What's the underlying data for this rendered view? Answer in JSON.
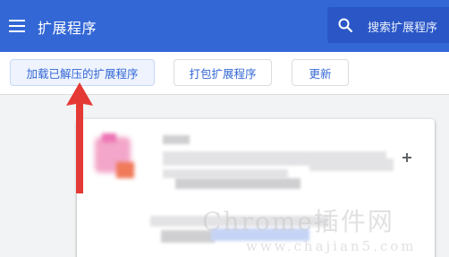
{
  "header": {
    "title": "扩展程序",
    "search_placeholder": "搜索扩展程序",
    "bg_color": "#3367d6"
  },
  "toolbar": {
    "load_unpacked_label": "加载已解压的扩展程序",
    "pack_label": "打包扩展程序",
    "update_label": "更新",
    "accent_color": "#3367d6"
  },
  "annotation": {
    "arrow_color": "#e53935"
  },
  "watermark": {
    "line1": "Chrome插件网",
    "line2": "www.chajian5.com"
  },
  "icons": [
    "menu-icon",
    "search-icon"
  ]
}
